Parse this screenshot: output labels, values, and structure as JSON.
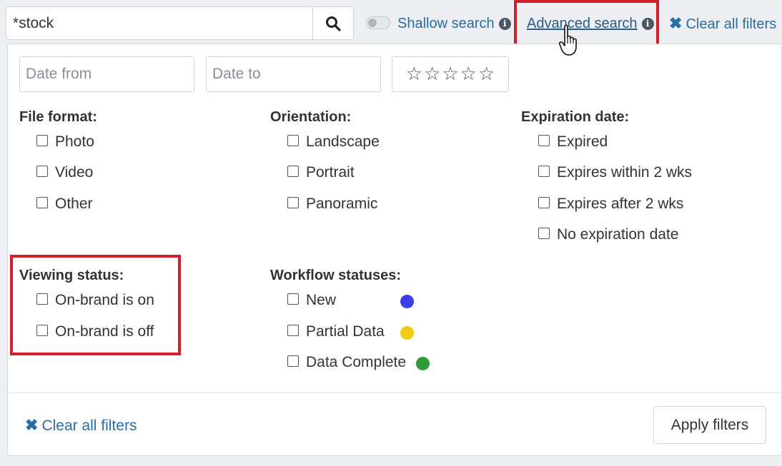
{
  "search": {
    "value": "*stock"
  },
  "toolbar": {
    "shallow_label": "Shallow search",
    "advanced_label": "Advanced search",
    "clear_label": "Clear all filters"
  },
  "panel": {
    "date_from_placeholder": "Date from",
    "date_to_placeholder": "Date to",
    "rating_stars": [
      "☆",
      "☆",
      "☆",
      "☆",
      "☆"
    ],
    "groups": {
      "file_format": {
        "title": "File format:",
        "options": [
          "Photo",
          "Video",
          "Other"
        ]
      },
      "orientation": {
        "title": "Orientation:",
        "options": [
          "Landscape",
          "Portrait",
          "Panoramic"
        ]
      },
      "expiration": {
        "title": "Expiration date:",
        "options": [
          "Expired",
          "Expires within 2 wks",
          "Expires after 2 wks",
          "No expiration date"
        ]
      },
      "viewing_status": {
        "title": "Viewing status:",
        "options": [
          "On-brand is on",
          "On-brand is off"
        ]
      },
      "workflow": {
        "title": "Workflow statuses:",
        "options": [
          "New",
          "Partial Data",
          "Data Complete"
        ],
        "colors": [
          "#3b3fe8",
          "#f2cc12",
          "#2e9a3a"
        ]
      }
    },
    "footer": {
      "clear_label": "Clear all filters",
      "apply_label": "Apply filters"
    }
  },
  "colors": {
    "link": "#2a6ea6",
    "highlight_box": "#d0202a"
  },
  "icons": {
    "search": "search-icon",
    "info": "info-icon",
    "close": "close-icon",
    "star": "star-outline-icon",
    "cursor": "hand-pointer-icon"
  }
}
